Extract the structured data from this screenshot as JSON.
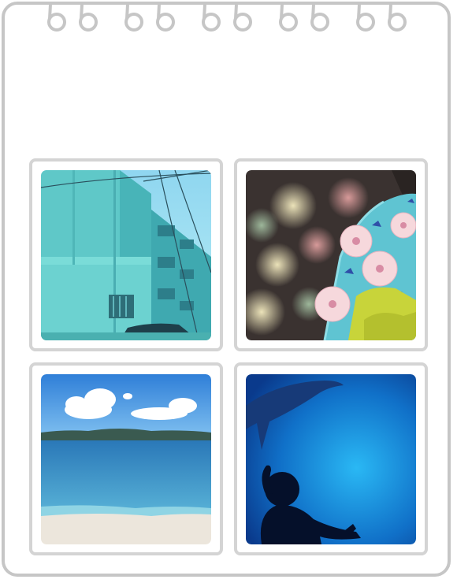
{
  "notebook": {
    "ring_count": 10,
    "border_color": "#c6c6c6",
    "card_border_color": "#d4d4d4"
  },
  "gallery": {
    "photos": [
      {
        "subject": "building-photo"
      },
      {
        "subject": "yukata-festival-photo"
      },
      {
        "subject": "beach-photo"
      },
      {
        "subject": "aquarium-photo"
      }
    ]
  }
}
